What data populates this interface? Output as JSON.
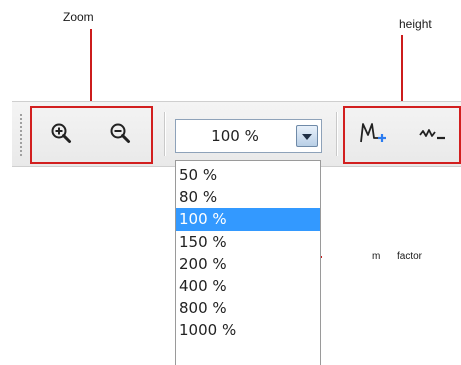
{
  "annotations": {
    "zoom": "Zoom",
    "height": "height",
    "factor_prefix": "m",
    "factor_word": "factor"
  },
  "toolbar": {
    "zoom_in_icon": "zoom-in-magnifier",
    "zoom_out_icon": "zoom-out-magnifier",
    "height_increase_icon": "waveform-plus",
    "height_decrease_icon": "waveform-minus"
  },
  "zoom_combo": {
    "value": "100 %",
    "options": [
      "50 %",
      "80 %",
      "100 %",
      "150 %",
      "200 %",
      "400 %",
      "800 %",
      "1000 %"
    ],
    "selected_index": 2
  },
  "colors": {
    "annotation_red": "#d21f1f",
    "selection_blue": "#3399ff"
  }
}
